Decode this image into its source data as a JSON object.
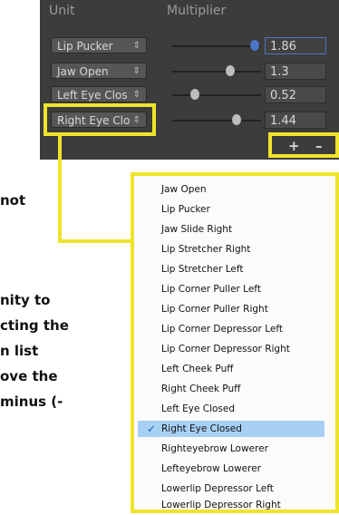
{
  "panel": {
    "headers": {
      "unit": "Unit",
      "multiplier": "Multiplier"
    },
    "rows": [
      {
        "unit": "Lip Pucker",
        "value": "1.86",
        "slider": 0.93
      },
      {
        "unit": "Jaw Open",
        "value": "1.3",
        "slider": 0.65
      },
      {
        "unit": "Left Eye Clos",
        "value": "0.52",
        "slider": 0.26
      },
      {
        "unit": "Right Eye Clo",
        "value": "1.44",
        "slider": 0.72
      }
    ],
    "dropdown_arrows": "⇕",
    "plus": "+",
    "minus": "–"
  },
  "left_text": {
    "line1": "not",
    "line2": "nity to",
    "line3": "cting the",
    "line4": "n list",
    "line5": "ove the",
    "line6": "minus (-"
  },
  "list": {
    "items": [
      "Jaw Open",
      "Lip Pucker",
      "Jaw Slide Right",
      "Lip Stretcher Right",
      "Lip Stretcher Left",
      "Lip Corner Puller Left",
      "Lip Corner Puller Right",
      "Lip Corner Depressor Left",
      "Lip Corner Depressor Right",
      "Left Cheek Puff",
      "Right Cheek Puff",
      "Left Eye Closed",
      "Right Eye Closed",
      "Righteyebrow Lowerer",
      "Lefteyebrow Lowerer",
      "Lowerlip Depressor Left",
      "Lowerlip Depressor Right"
    ],
    "selected": "Right Eye Closed",
    "check": "✓"
  },
  "colors": {
    "highlight": "#f0e42b",
    "selection": "#a8d0f5",
    "panel": "#3c3c3c"
  }
}
